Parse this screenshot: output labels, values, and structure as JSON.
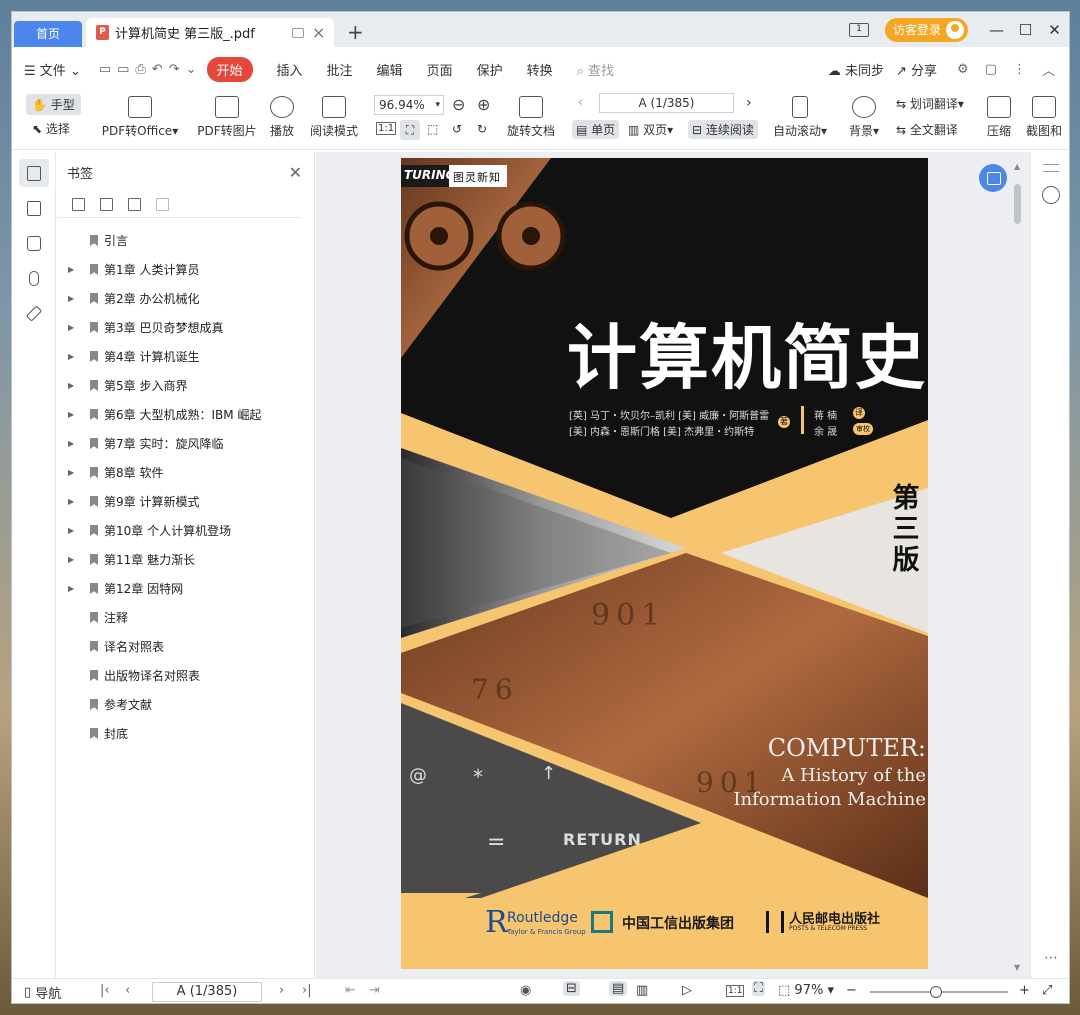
{
  "titlebar": {
    "home_tab": "首页",
    "doc_tab": "计算机简史 第三版_.pdf",
    "pdf_badge": "P",
    "login_label": "访客登录",
    "monitor_label": "1"
  },
  "menu": {
    "file": "文件",
    "start": "开始",
    "insert": "插入",
    "annotate": "批注",
    "edit": "编辑",
    "page": "页面",
    "protect": "保护",
    "convert": "转换",
    "search": "查找",
    "unsynced": "未同步",
    "share": "分享"
  },
  "ribbon": {
    "hand": "手型",
    "select": "选择",
    "to_office": "PDF转Office",
    "to_image": "PDF转图片",
    "play": "播放",
    "read_mode": "阅读模式",
    "zoom": "96.94%",
    "page_box": "A (1/385)",
    "rotate": "旋转文档",
    "single": "单页",
    "double": "双页",
    "continuous": "连续阅读",
    "auto_scroll": "自动滚动",
    "background": "背景",
    "word_translate": "划词翻译",
    "full_translate": "全文翻译",
    "compress": "压缩",
    "screenshot": "截图和",
    "actual_size": "1:1"
  },
  "bookmarks": {
    "title": "书签",
    "items": [
      {
        "label": "引言",
        "expandable": false
      },
      {
        "label": "第1章 人类计算员",
        "expandable": true
      },
      {
        "label": "第2章 办公机械化",
        "expandable": true
      },
      {
        "label": "第3章 巴贝奇梦想成真",
        "expandable": true
      },
      {
        "label": "第4章 计算机诞生",
        "expandable": true
      },
      {
        "label": "第5章 步入商界",
        "expandable": true
      },
      {
        "label": "第6章 大型机成熟：IBM 崛起",
        "expandable": true
      },
      {
        "label": "第7章 实时：旋风降临",
        "expandable": true
      },
      {
        "label": "第8章 软件",
        "expandable": true
      },
      {
        "label": "第9章 计算新模式",
        "expandable": true
      },
      {
        "label": "第10章 个人计算机登场",
        "expandable": true
      },
      {
        "label": "第11章 魅力渐长",
        "expandable": true
      },
      {
        "label": "第12章 因特网",
        "expandable": true
      },
      {
        "label": "注释",
        "expandable": false
      },
      {
        "label": "译名对照表",
        "expandable": false
      },
      {
        "label": "出版物译名对照表",
        "expandable": false
      },
      {
        "label": "参考文献",
        "expandable": false
      },
      {
        "label": "封底",
        "expandable": false
      }
    ]
  },
  "cover": {
    "series_logo": "TURING",
    "series_name": "图灵新知",
    "title_cn": "计算机简史",
    "authors_line1": "[英] 马丁・坎贝尔–凯利  [美] 威廉・阿斯普雷",
    "authors_line2": "[美] 内森・恩斯门格  [美] 杰弗里・约斯特",
    "author_role": "著",
    "translators": [
      "蒋  楠",
      "余  晟"
    ],
    "translator_roles": [
      "译",
      "审校"
    ],
    "edition": "第三版",
    "title_en_1": "COMPUTER:",
    "title_en_2": "A History of the",
    "title_en_3": "Information Machine",
    "key_numbers": [
      "901",
      "76",
      "901"
    ],
    "key_labels": [
      "@",
      "*",
      "↑",
      "=",
      "RETURN"
    ],
    "publisher_1": "Routledge",
    "publisher_1_sub": "Taylor & Francis Group",
    "publisher_2": "中国工信出版集团",
    "publisher_3": "人民邮电出版社",
    "publisher_3_sub": "POSTS & TELECOM PRESS"
  },
  "status": {
    "nav": "导航",
    "page_box": "A (1/385)",
    "zoom": "97%",
    "actual_size": "1:1"
  },
  "colors": {
    "accent": "#4c86ec",
    "start_tab": "#e6473c",
    "login": "#f5a623",
    "cover_yellow": "#f7c46f",
    "cover_black": "#111111",
    "cover_copper": "#8a4a2a"
  }
}
